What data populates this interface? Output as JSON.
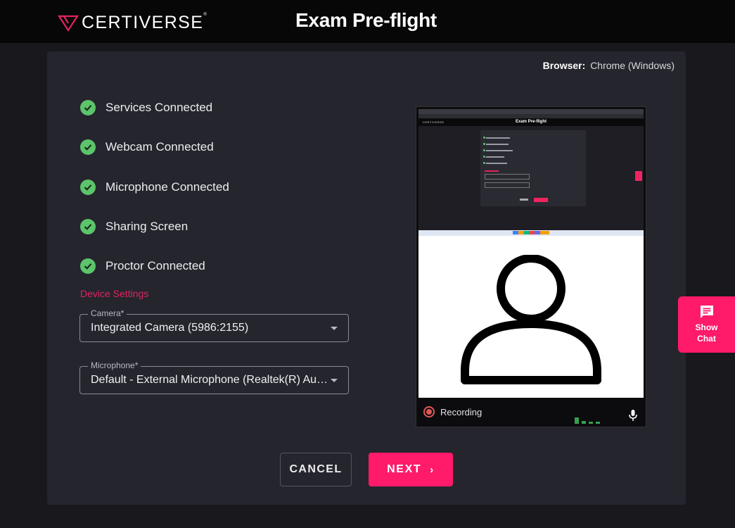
{
  "header": {
    "logo_text": "CERTIVERSE",
    "logo_mark": "®",
    "title": "Exam Pre-flight"
  },
  "browser": {
    "label": "Browser:",
    "value": "Chrome (Windows)"
  },
  "checks": [
    {
      "label": "Services Connected",
      "status": "ok"
    },
    {
      "label": "Webcam Connected",
      "status": "ok"
    },
    {
      "label": "Microphone Connected",
      "status": "ok"
    },
    {
      "label": "Sharing Screen",
      "status": "ok"
    },
    {
      "label": "Proctor Connected",
      "status": "ok"
    }
  ],
  "device_settings": {
    "title": "Device Settings",
    "camera": {
      "label": "Camera*",
      "value": "Integrated Camera (5986:2155)"
    },
    "microphone": {
      "label": "Microphone*",
      "value": "Default - External Microphone (Realtek(R) Audio)"
    }
  },
  "preview": {
    "mini_title": "Exam Pre-flight",
    "mini_logo": "CERTIVERSE",
    "recording_label": "Recording",
    "mic_level": 0.4
  },
  "actions": {
    "cancel_label": "CANCEL",
    "next_label": "NEXT",
    "next_chevron": "›"
  },
  "chat": {
    "label_line1": "Show",
    "label_line2": "Chat"
  },
  "colors": {
    "accent": "#ff1a6a",
    "success": "#5cc46b",
    "settings_title": "#e0245e",
    "card_bg": "#25252e",
    "page_bg": "#18181d"
  },
  "icons": [
    "certiverse-logo-icon",
    "check-circle-icon",
    "dropdown-arrow-icon",
    "person-icon",
    "record-icon",
    "mic-icon",
    "chat-icon",
    "chevron-right-icon"
  ]
}
